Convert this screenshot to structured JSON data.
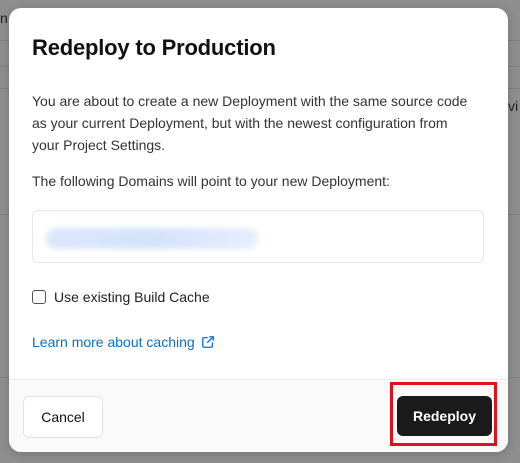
{
  "background": {
    "fragments": [
      "n",
      "vi"
    ]
  },
  "modal": {
    "title": "Redeploy to Production",
    "description": "You are about to create a new Deployment with the same source code as your current Deployment, but with the newest configuration from your Project Settings.",
    "domains_label": "The following Domains will point to your new Deployment:",
    "checkbox_label": "Use existing Build Cache",
    "checkbox_checked": false,
    "learn_link": "Learn more about caching",
    "link_icon": "external-link-icon",
    "cancel_label": "Cancel",
    "redeploy_label": "Redeploy"
  },
  "colors": {
    "link": "#0a6fd0",
    "primary_button": "#1a1a1a",
    "highlight_border": "#e1101c"
  }
}
